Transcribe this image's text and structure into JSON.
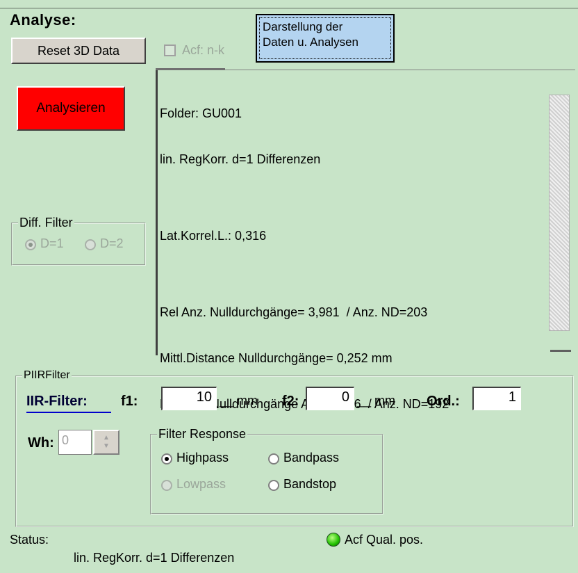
{
  "analysis": {
    "title": "Analyse:",
    "reset_button": "Reset 3D Data",
    "analyse_button": "Analysieren",
    "display_button_line1": "Darstellung der",
    "display_button_line2": "Daten u. Analysen",
    "acf_checkbox_label": "Acf: n-k"
  },
  "output": {
    "lines": [
      "Folder: GU001",
      "lin. RegKorr. d=1 Differenzen",
      "",
      "Lat.Korrel.L.: 0,316",
      "",
      "Rel Anz. Nulldurchgänge= 3,981  / Anz. ND=203",
      "Mittl.Distance Nulldurchgänge= 0,252 mm",
      "Rel.Anz. Nulldurchgänge Acf= 3,746  / Anz. ND=192"
    ]
  },
  "diff_filter": {
    "legend": "Diff. Filter",
    "options": [
      "D=1",
      "D=2"
    ],
    "selected": "D=1"
  },
  "piirfilter": {
    "legend": "PIIRFilter",
    "iir_link": "IIR-Filter:",
    "f1_label": "f1:",
    "f1_value": "10",
    "f1_unit": "__ mm",
    "f2_label": "f2:",
    "f2_value": "0",
    "f2_unit": "__ mm",
    "ord_label": "Ord.:",
    "ord_value": "1",
    "wh_label": "Wh:",
    "wh_value": "0"
  },
  "filter_response": {
    "legend": "Filter Response",
    "options": [
      "Highpass",
      "Bandpass",
      "Lowpass",
      "Bandstop"
    ],
    "selected": "Highpass"
  },
  "status": {
    "label": "Status:",
    "text": "lin. RegKorr. d=1 Differenzen",
    "acf_qual": "Acf Qual. pos.",
    "led_color": "#20c000"
  }
}
